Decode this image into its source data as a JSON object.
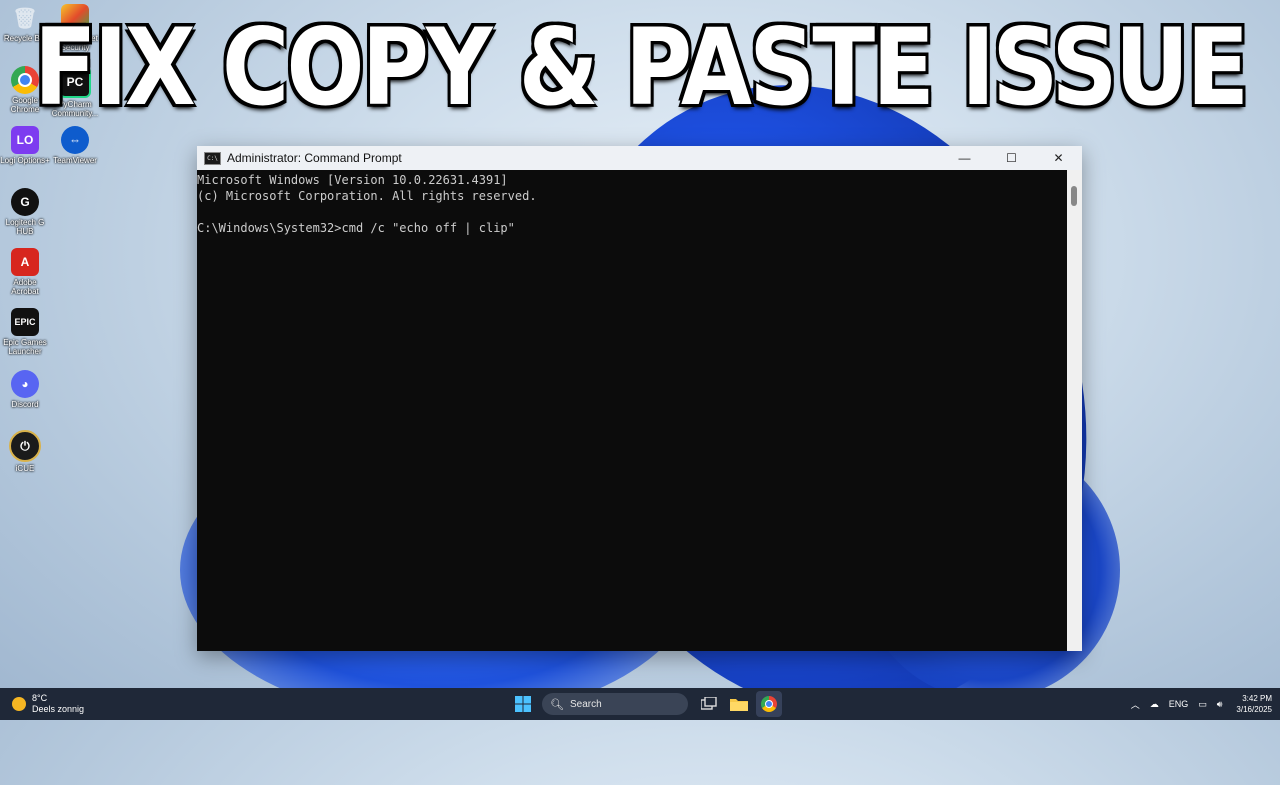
{
  "headline": "FIX COPY & PASTE ISSUE",
  "desktop_icons": [
    {
      "label": "Recycle Bin",
      "icon": "recycle-bin-icon"
    },
    {
      "label": "AVG Internet Security",
      "icon": "avg-icon"
    },
    {
      "label": "Google Chrome",
      "icon": "chrome-icon"
    },
    {
      "label": "PyCharm Community...",
      "icon": "pycharm-icon"
    },
    {
      "label": "Logi Options+",
      "icon": "logi-options-icon"
    },
    {
      "label": "TeamViewer",
      "icon": "teamviewer-icon"
    },
    {
      "label": "Logitech G HUB",
      "icon": "logitech-ghub-icon"
    },
    {
      "label": "Adobe Acrobat",
      "icon": "adobe-acrobat-icon"
    },
    {
      "label": "Epic Games Launcher",
      "icon": "epic-games-icon"
    },
    {
      "label": "Discord",
      "icon": "discord-icon"
    },
    {
      "label": "iCUE",
      "icon": "icue-icon"
    }
  ],
  "window": {
    "title": "Administrator: Command Prompt",
    "icon": "cmd-icon",
    "controls": {
      "minimize": "—",
      "maximize": "☐",
      "close": "✕"
    }
  },
  "console": {
    "lines": [
      "Microsoft Windows [Version 10.0.22631.4391]",
      "(c) Microsoft Corporation. All rights reserved.",
      "",
      "C:\\Windows\\System32>cmd /c \"echo off | clip\""
    ]
  },
  "taskbar": {
    "weather_temp": "8°C",
    "weather_desc": "Deels zonnig",
    "search_placeholder": "Search",
    "language": "ENG",
    "time": "3:42 PM",
    "date": "3/16/2025"
  }
}
